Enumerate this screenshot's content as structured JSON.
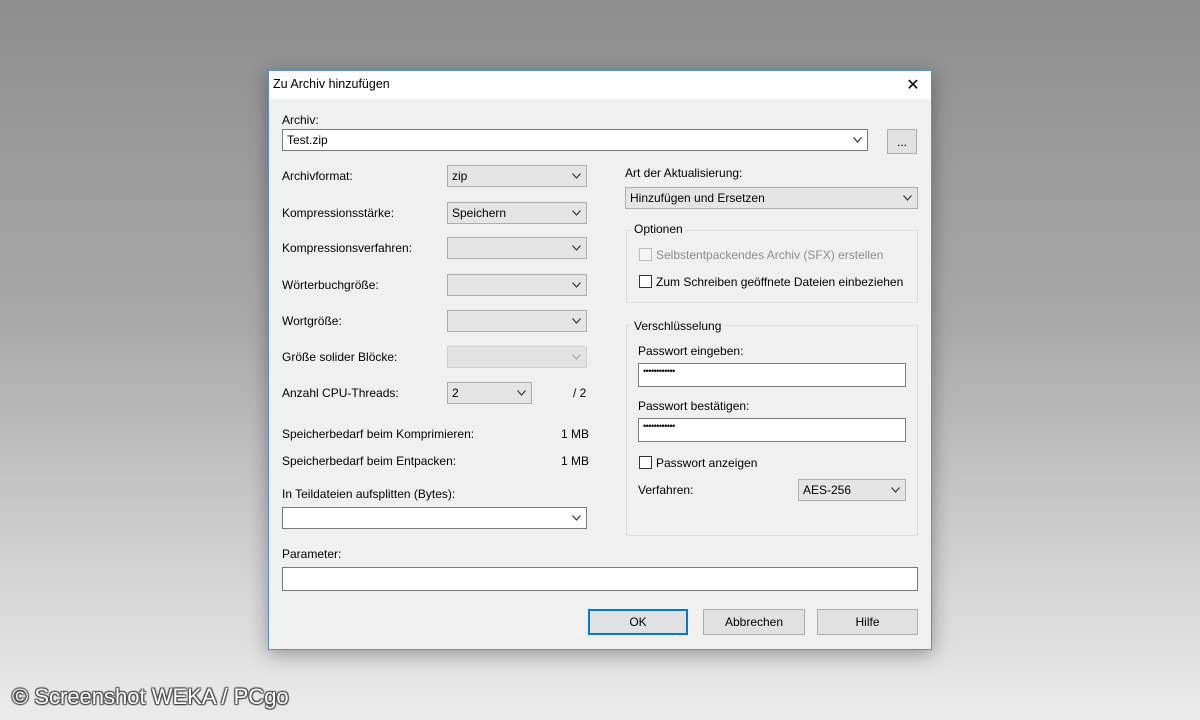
{
  "dialog": {
    "title": "Zu Archiv hinzufügen",
    "archive_label": "Archiv:",
    "archive_value": "Test.zip",
    "browse_label": "..."
  },
  "left": {
    "format_label": "Archivformat:",
    "format_value": "zip",
    "level_label": "Kompressionsstärke:",
    "level_value": "Speichern",
    "method_label": "Kompressionsverfahren:",
    "method_value": "",
    "dict_label": "Wörterbuchgröße:",
    "dict_value": "",
    "word_label": "Wortgröße:",
    "word_value": "",
    "solid_label": "Größe solider Blöcke:",
    "solid_value": "",
    "threads_label": "Anzahl CPU-Threads:",
    "threads_value": "2",
    "threads_max": "/ 2",
    "mem_compress_label": "Speicherbedarf beim Komprimieren:",
    "mem_compress_value": "1 MB",
    "mem_decompress_label": "Speicherbedarf beim Entpacken:",
    "mem_decompress_value": "1 MB",
    "split_label": "In Teildateien aufsplitten (Bytes):",
    "split_value": ""
  },
  "right": {
    "update_label": "Art der Aktualisierung:",
    "update_value": "Hinzufügen und Ersetzen",
    "options_title": "Optionen",
    "sfx_label": "Selbstentpackendes Archiv (SFX) erstellen",
    "shared_label": "Zum Schreiben geöffnete Dateien einbeziehen",
    "encryption_title": "Verschlüsselung",
    "pw_label": "Passwort eingeben:",
    "pw_value": "••••••••••••",
    "pw_confirm_label": "Passwort bestätigen:",
    "pw_confirm_value": "••••••••••••",
    "show_pw_label": "Passwort anzeigen",
    "enc_method_label": "Verfahren:",
    "enc_method_value": "AES-256"
  },
  "bottom": {
    "params_label": "Parameter:",
    "params_value": "",
    "ok_label": "OK",
    "cancel_label": "Abbrechen",
    "help_label": "Hilfe"
  },
  "watermark": "© Screenshot WEKA / PCgo"
}
